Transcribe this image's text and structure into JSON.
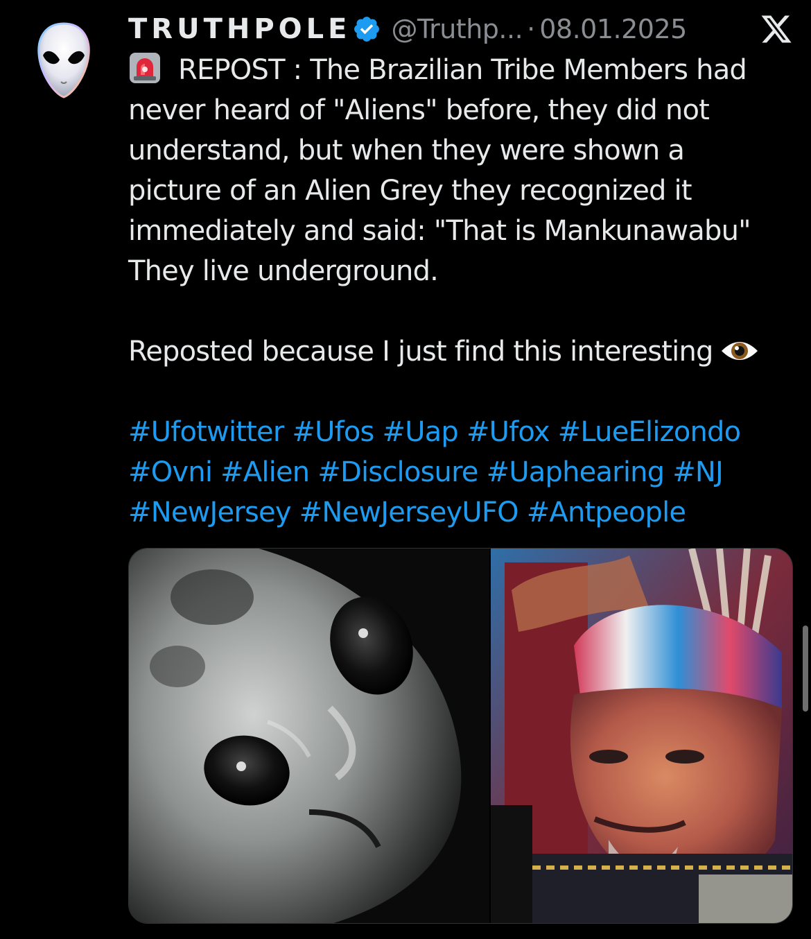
{
  "post": {
    "author_name": "TRUTHPOLE",
    "handle": "@Truthp...",
    "separator": "·",
    "date": "08.01.2025",
    "text_lines": [
      "REPOST  : The Brazilian Tribe Members had",
      "never heard of \"Aliens\" before, they did not",
      "understand, but when they were shown a",
      "picture of an Alien Grey they recognized it",
      "immediately and said: \"That is Mankunawabu\"",
      "They live underground."
    ],
    "second_paragraph": "Reposted because I just find this interesting",
    "hashtag_lines": [
      [
        "#Ufotwitter",
        "#Ufos",
        "#Uap",
        "#Ufox",
        "#LueElizondo"
      ],
      [
        "#Ovni",
        "#Alien",
        "#Disclosure",
        "#Uaphearing",
        "#NJ"
      ],
      [
        "#NewJersey",
        "#NewJerseyUFO",
        "#Antpeople"
      ]
    ]
  },
  "icons": {
    "avatar": "alien-avatar-icon",
    "verified": "verified-badge-icon",
    "x_logo": "x-logo-icon",
    "siren": "siren-emoji-icon",
    "eye": "eye-emoji-icon"
  },
  "colors": {
    "background": "#000000",
    "text": "#e7e9ea",
    "muted": "#8a8d91",
    "link": "#1d9bf0",
    "verified": "#1d9bf0"
  }
}
